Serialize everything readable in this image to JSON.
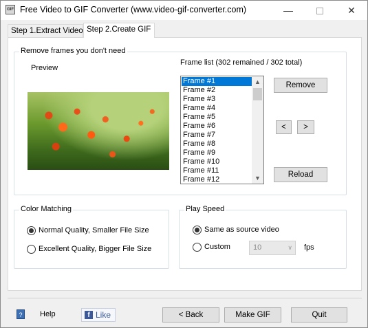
{
  "window": {
    "title": "Free Video to GIF Converter (www.video-gif-converter.com)",
    "minimize_glyph": "—",
    "close_glyph": "✕"
  },
  "tabs": [
    {
      "label": "Step 1.Extract Video",
      "active": false
    },
    {
      "label": "Step 2.Create GIF",
      "active": true
    }
  ],
  "frames_group": {
    "label": "Remove frames you don't need",
    "preview_label": "Preview",
    "list_label": "Frame list (302 remained / 302 total)",
    "frames": [
      "Frame #1",
      "Frame #2",
      "Frame #3",
      "Frame #4",
      "Frame #5",
      "Frame #6",
      "Frame #7",
      "Frame #8",
      "Frame #9",
      "Frame #10",
      "Frame #11",
      "Frame #12"
    ],
    "selected_index": 0,
    "remove_label": "Remove",
    "prev_label": "<",
    "next_label": ">",
    "reload_label": "Reload"
  },
  "color_group": {
    "label": "Color Matching",
    "options": [
      {
        "label": "Normal Quality, Smaller File Size",
        "checked": true
      },
      {
        "label": "Excellent Quality, Bigger File Size",
        "checked": false
      }
    ]
  },
  "speed_group": {
    "label": "Play Speed",
    "options": [
      {
        "label": "Same as source video",
        "checked": true
      },
      {
        "label": "Custom",
        "checked": false
      }
    ],
    "custom_value": "10",
    "unit": "fps"
  },
  "footer": {
    "help_label": "Help",
    "like_label": "Like",
    "back_label": "< Back",
    "makegif_label": "Make GIF",
    "quit_label": "Quit"
  }
}
